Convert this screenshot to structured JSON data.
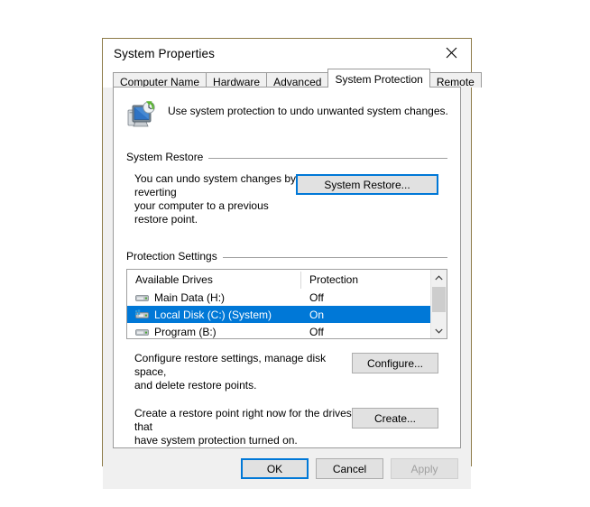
{
  "window": {
    "title": "System Properties",
    "close_label": "Close",
    "border_color": "#8d7b48"
  },
  "tabs": [
    {
      "label": "Computer Name",
      "active": false
    },
    {
      "label": "Hardware",
      "active": false
    },
    {
      "label": "Advanced",
      "active": false
    },
    {
      "label": "System Protection",
      "active": true
    },
    {
      "label": "Remote",
      "active": false
    }
  ],
  "header": {
    "icon": "system-restore-icon",
    "text": "Use system protection to undo unwanted system changes."
  },
  "system_restore": {
    "group_label": "System Restore",
    "description_line1": "You can undo system changes by reverting",
    "description_line2": "your computer to a previous restore point.",
    "button_label": "System Restore...",
    "button_focused": true
  },
  "protection_settings": {
    "group_label": "Protection Settings",
    "columns": [
      "Available Drives",
      "Protection"
    ],
    "drives": [
      {
        "name": "Main Data (H:)",
        "protection": "Off",
        "icon": "drive-icon",
        "selected": false
      },
      {
        "name": "Local Disk (C:) (System)",
        "protection": "On",
        "icon": "system-drive-icon",
        "selected": true
      },
      {
        "name": "Program (B:)",
        "protection": "Off",
        "icon": "drive-icon",
        "selected": false
      }
    ],
    "scrollbar": {
      "up": "˄",
      "down": "˅"
    },
    "configure": {
      "description_line1": "Configure restore settings, manage disk space,",
      "description_line2": "and delete restore points.",
      "button_label": "Configure..."
    },
    "create": {
      "description_line1": "Create a restore point right now for the drives that",
      "description_line2": "have system protection turned on.",
      "button_label": "Create..."
    }
  },
  "footer": {
    "ok": "OK",
    "cancel": "Cancel",
    "apply": "Apply",
    "apply_disabled": true
  },
  "colors": {
    "accent": "#0078d7",
    "dialog_bg": "#f0f0f0",
    "selection": "#0078d7"
  }
}
